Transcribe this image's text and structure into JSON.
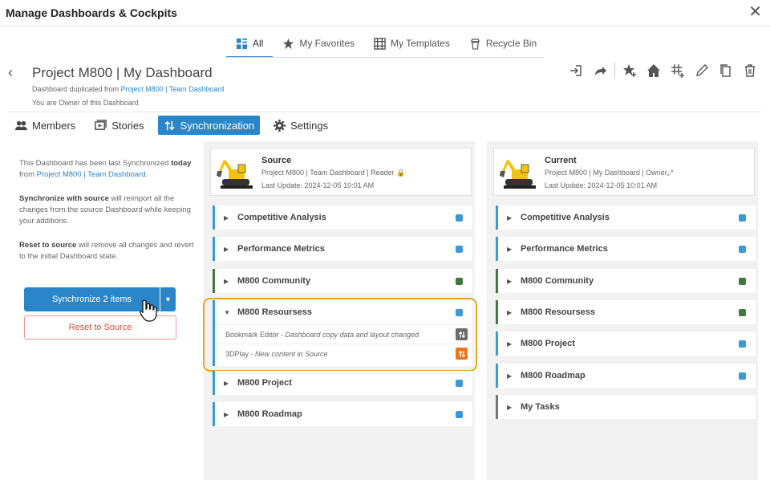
{
  "window": {
    "title": "Manage Dashboards & Cockpits"
  },
  "tabs": [
    {
      "label": "All",
      "icon": "grid-icon",
      "active": true
    },
    {
      "label": "My Favorites",
      "icon": "star-icon"
    },
    {
      "label": "My Templates",
      "icon": "template-grid-icon"
    },
    {
      "label": "Recycle Bin",
      "icon": "recycle-bin-icon"
    }
  ],
  "dashboard": {
    "title": "Project M800 | My Dashboard",
    "dup_prefix": "Dashboard duplicated from ",
    "dup_link": "Project M800 | Team Dashboard",
    "owner_text": "You are Owner of this Dashboard"
  },
  "subtabs": [
    {
      "label": "Members",
      "icon": "members-icon"
    },
    {
      "label": "Stories",
      "icon": "stories-icon"
    },
    {
      "label": "Synchronization",
      "icon": "sync-icon",
      "active": true
    },
    {
      "label": "Settings",
      "icon": "gear-icon"
    }
  ],
  "left": {
    "p1_a": "This Dashboard has been last Synchronized ",
    "p1_b": "today",
    "p1_c": " from ",
    "p1_link": "Project M800 | Team Dashboard",
    "p1_d": ".",
    "p2_b": "Synchronize with source",
    "p2_rest": " will reimport all the changes from the source Dashboard while keeping your additions.",
    "p3_b": "Reset to source",
    "p3_rest": " will remove all changes and revert to the initial Dashboard state.",
    "sync_btn": "Synchronize 2 items",
    "reset_btn": "Reset to Source"
  },
  "source": {
    "title": "Source",
    "sub": "Project M800 | Team Dashboard | Reader",
    "date": "Last Update: 2024-12-05 10:01 AM",
    "items": [
      "Competitive Analysis",
      "Performance Metrics",
      "M800 Community",
      "M800 Resoursess",
      "M800 Project",
      "M800 Roadmap"
    ],
    "expanded_children": [
      {
        "name": "Bookmark Editor - ",
        "desc": "Dashboard copy data and layout changed"
      },
      {
        "name": "3DPlay - ",
        "desc": "New content in Source"
      }
    ]
  },
  "current": {
    "title": "Current",
    "sub": "Project M800 | My Dashboard | Owner",
    "date": "Last Update: 2024-12-05 10:01 AM",
    "items": [
      "Competitive Analysis",
      "Performance Metrics",
      "M800 Community",
      "M800 Resoursess",
      "M800 Project",
      "M800 Roadmap",
      "My Tasks"
    ]
  },
  "colors": {
    "accent": "#2a86c8",
    "highlight": "#e7a521",
    "green": "#3f7a3a",
    "orange": "#e8791d",
    "reset": "#d2503c"
  }
}
